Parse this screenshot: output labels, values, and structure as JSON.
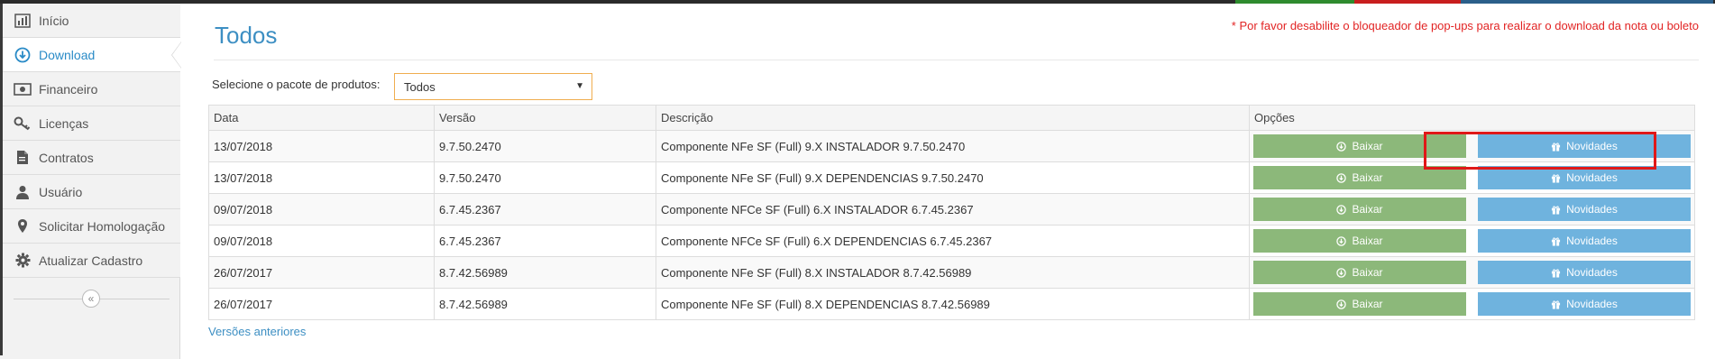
{
  "colors": {
    "accent": "#3d8fc3",
    "alert": "#e22424",
    "baixar_button": "#8cb87a",
    "novidades_button": "#6fb3de",
    "highlight": "#e01818",
    "select_border": "#f0ad4e"
  },
  "sidebar": {
    "items": [
      {
        "label": "Início",
        "icon": "bar-chart-icon",
        "active": false
      },
      {
        "label": "Download",
        "icon": "download-icon",
        "active": true
      },
      {
        "label": "Financeiro",
        "icon": "money-icon",
        "active": false
      },
      {
        "label": "Licenças",
        "icon": "key-icon",
        "active": false
      },
      {
        "label": "Contratos",
        "icon": "document-icon",
        "active": false
      },
      {
        "label": "Usuário",
        "icon": "user-icon",
        "active": false
      },
      {
        "label": "Solicitar Homologação",
        "icon": "map-marker-icon",
        "active": false
      },
      {
        "label": "Atualizar Cadastro",
        "icon": "gear-icon",
        "active": false
      }
    ],
    "collapse_icon": "double-chevron-left-icon"
  },
  "main": {
    "title": "Todos",
    "popup_note": "* Por favor desabilite o bloqueador de pop-ups para realizar o download da nota ou boleto",
    "package_label": "Selecione o pacote de produtos:",
    "package_selected": "Todos",
    "table": {
      "headers": [
        "Data",
        "Versão",
        "Descrição",
        "Opções"
      ],
      "rows": [
        {
          "data": "13/07/2018",
          "versao": "9.7.50.2470",
          "descricao": "Componente NFe SF (Full) 9.X INSTALADOR 9.7.50.2470"
        },
        {
          "data": "13/07/2018",
          "versao": "9.7.50.2470",
          "descricao": "Componente NFe SF (Full) 9.X DEPENDENCIAS 9.7.50.2470"
        },
        {
          "data": "09/07/2018",
          "versao": "6.7.45.2367",
          "descricao": "Componente NFCe SF (Full) 6.X INSTALADOR 6.7.45.2367"
        },
        {
          "data": "09/07/2018",
          "versao": "6.7.45.2367",
          "descricao": "Componente NFCe SF (Full) 6.X DEPENDENCIAS 6.7.45.2367"
        },
        {
          "data": "26/07/2017",
          "versao": "8.7.42.56989",
          "descricao": "Componente NFe SF (Full) 8.X INSTALADOR 8.7.42.56989"
        },
        {
          "data": "26/07/2017",
          "versao": "8.7.42.56989",
          "descricao": "Componente NFe SF (Full) 8.X DEPENDENCIAS 8.7.42.56989"
        }
      ],
      "baixar_label": "Baixar",
      "baixar_icon": "download-circle-icon",
      "novidades_label": "Novidades",
      "novidades_icon": "gift-icon"
    },
    "older_versions_link": "Versões anteriores"
  }
}
